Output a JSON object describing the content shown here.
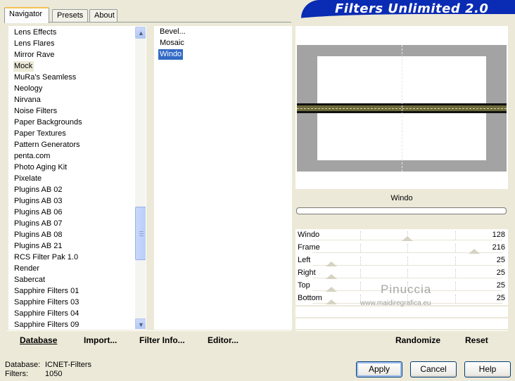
{
  "tabs": [
    {
      "label": "Navigator",
      "active": true
    },
    {
      "label": "Presets",
      "active": false
    },
    {
      "label": "About",
      "active": false
    }
  ],
  "banner": "Filters Unlimited 2.0",
  "categories": [
    "Lens Effects",
    "Lens Flares",
    "Mirror Rave",
    "Mock",
    "MuRa's Seamless",
    "Neology",
    "Nirvana",
    "Noise Filters",
    "Paper Backgrounds",
    "Paper Textures",
    "Pattern Generators",
    "penta.com",
    "Photo Aging Kit",
    "Pixelate",
    "Plugins AB 02",
    "Plugins AB 03",
    "Plugins AB 06",
    "Plugins AB 07",
    "Plugins AB 08",
    "Plugins AB 21",
    "RCS Filter Pak 1.0",
    "Render",
    "Sabercat",
    "Sapphire Filters 01",
    "Sapphire Filters 03",
    "Sapphire Filters 04",
    "Sapphire Filters 09"
  ],
  "selected_category": "Mock",
  "filters": [
    "Bevel...",
    "Mosaic",
    "Windo"
  ],
  "selected_filter": "Windo",
  "left_buttons": {
    "database": "Database",
    "import": "Import...",
    "filter_info": "Filter Info...",
    "editor": "Editor..."
  },
  "preview": {
    "filter_title": "Windo",
    "progress": 0
  },
  "params": [
    {
      "label": "Windo",
      "value": "128",
      "level": 0.5
    },
    {
      "label": "Frame",
      "value": "216",
      "level": 0.85
    },
    {
      "label": "Left",
      "value": "25",
      "level": 0.1
    },
    {
      "label": "Right",
      "value": "25",
      "level": 0.1
    },
    {
      "label": "Top",
      "value": "25",
      "level": 0.1
    },
    {
      "label": "Bottom",
      "value": "25",
      "level": 0.1
    }
  ],
  "watermark": {
    "name": "Pinuccia",
    "url": "www.maidiregrafica.eu"
  },
  "right_buttons": {
    "randomize": "Randomize",
    "reset": "Reset"
  },
  "status": {
    "database_label": "Database:",
    "database_value": "ICNET-Filters",
    "filters_label": "Filters:",
    "filters_value": "1050"
  },
  "dialog_buttons": {
    "apply": "Apply",
    "cancel": "Cancel",
    "help": "Help"
  },
  "colors": {
    "banner": "#0a2bb3",
    "selection": "#316ac5",
    "face": "#ece9d8"
  }
}
